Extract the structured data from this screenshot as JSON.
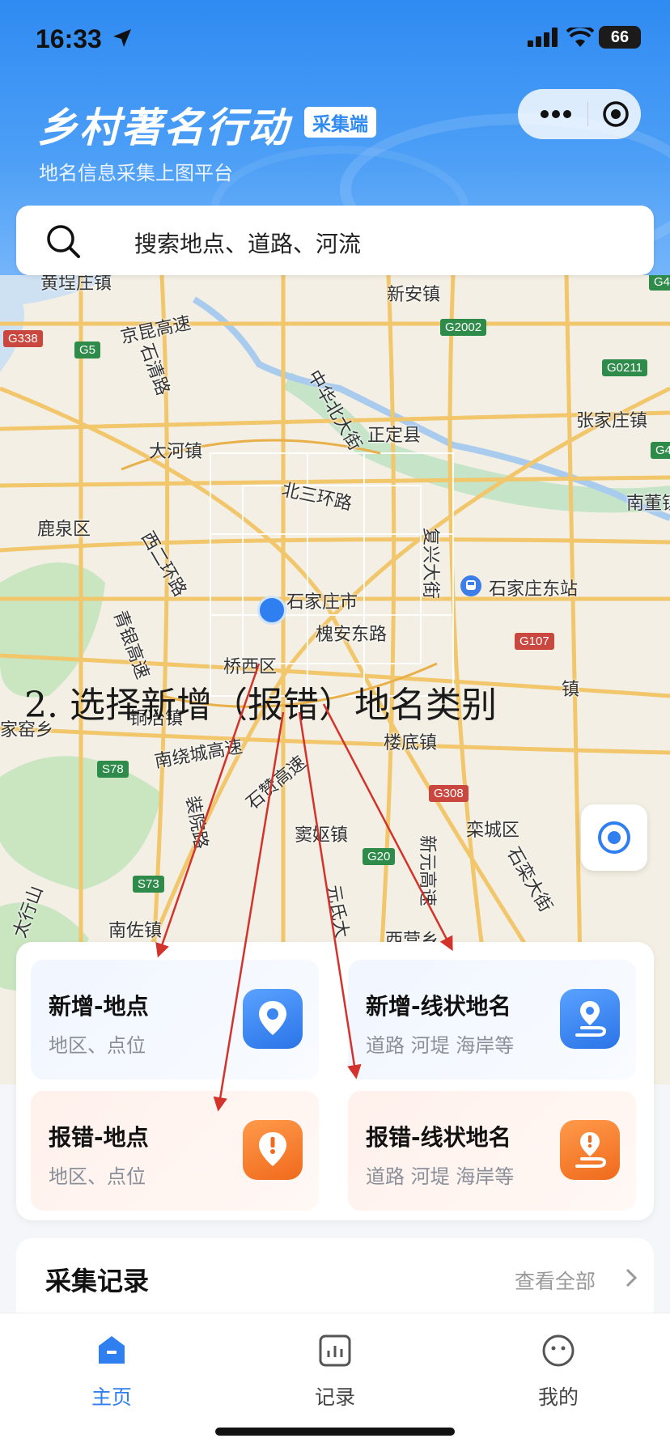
{
  "status": {
    "time": "16:33",
    "battery": "66"
  },
  "header": {
    "title": "乡村著名行动",
    "tag": "采集端",
    "subtitle": "地名信息采集上图平台"
  },
  "search": {
    "placeholder": "搜索地点、道路、河流"
  },
  "map": {
    "labels": {
      "l1": "黄埕庄镇",
      "l2": "新安镇",
      "l3": "京昆高速",
      "l4": "石清路",
      "l5": "中华北大街",
      "l6": "正定县",
      "l7": "张家庄镇",
      "l8": "大河镇",
      "l9": "北三环路",
      "l10": "南董镇",
      "l11": "鹿泉区",
      "l12": "西二环路",
      "l13": "复兴大街",
      "l14": "石家庄东站",
      "l15": "石家庄市",
      "l16": "槐安东路",
      "l17": "青银高速",
      "l18": "桥西区",
      "l19": "铜冶镇",
      "l20": "楼底镇",
      "l21": "家窑乡",
      "l22": "南绕城高速",
      "l23": "石赞高速",
      "l24": "窦妪镇",
      "l25": "栾城区",
      "l26": "装院路",
      "l27": "新元高速",
      "l28": "石栾大街",
      "l29": "元氏大",
      "l30": "南佐镇",
      "l31": "太行山",
      "l32": "西营乡",
      "l33": "镇"
    },
    "shields": {
      "s1": "G338",
      "s2": "G5",
      "s3": "G2002",
      "s4": "G0211",
      "s5": "G107",
      "s6": "S78",
      "s7": "G308",
      "s8": "G20",
      "s9": "S73",
      "s10": "G4",
      "s11": "G4"
    }
  },
  "instruction": "2. 选择新增（报错）地名类别",
  "actions": {
    "add_place": {
      "title": "新增-地点",
      "sub": "地区、点位"
    },
    "add_line": {
      "title": "新增-线状地名",
      "sub": "道路 河堤 海岸等"
    },
    "err_place": {
      "title": "报错-地点",
      "sub": "地区、点位"
    },
    "err_line": {
      "title": "报错-线状地名",
      "sub": "道路 河堤 海岸等"
    }
  },
  "records": {
    "title": "采集记录",
    "all": "查看全部"
  },
  "tabs": {
    "home": "主页",
    "record": "记录",
    "mine": "我的"
  },
  "colors": {
    "primary": "#2f7ff0",
    "error": "#f06a1d",
    "arrow": "#d3332b"
  }
}
